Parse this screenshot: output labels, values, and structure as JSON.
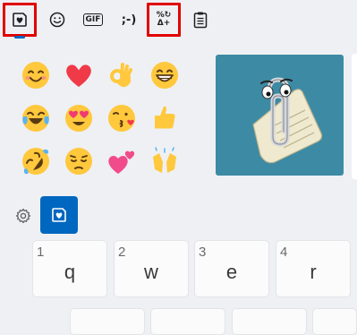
{
  "tabs": [
    {
      "name": "emoji",
      "icon": "heart-sticker-icon",
      "highlighted": true,
      "selected": true
    },
    {
      "name": "kaomoji-smiley",
      "icon": "smiley-icon",
      "highlighted": false
    },
    {
      "name": "gif",
      "label": "GIF",
      "icon": "gif-icon",
      "highlighted": false
    },
    {
      "name": "kaomoji",
      "label": ";-)",
      "icon": "kaomoji-icon",
      "highlighted": false
    },
    {
      "name": "symbols",
      "label_top": "%↻",
      "label_bottom": "Δ+",
      "icon": "symbols-icon",
      "highlighted": true
    },
    {
      "name": "clipboard",
      "icon": "clipboard-icon",
      "highlighted": false
    }
  ],
  "emojis": [
    "smiling-face-icon",
    "red-heart-icon",
    "ok-hand-icon",
    "grinning-face-icon",
    "tears-of-joy-icon",
    "heart-eyes-icon",
    "face-blowing-kiss-icon",
    "thumbs-up-icon",
    "rolling-laughing-icon",
    "pensive-face-icon",
    "two-hearts-icon",
    "raising-hands-icon"
  ],
  "sticker": {
    "icon": "clippy-sticker-icon",
    "background": "#3d8aa4"
  },
  "colors": {
    "accent": "#0067c0",
    "highlight": "#e00000",
    "background": "#eef0f3"
  },
  "keyboard": {
    "keys": [
      {
        "num": "1",
        "letter": "q"
      },
      {
        "num": "2",
        "letter": "w"
      },
      {
        "num": "3",
        "letter": "e"
      },
      {
        "num": "4",
        "letter": "r"
      }
    ]
  }
}
